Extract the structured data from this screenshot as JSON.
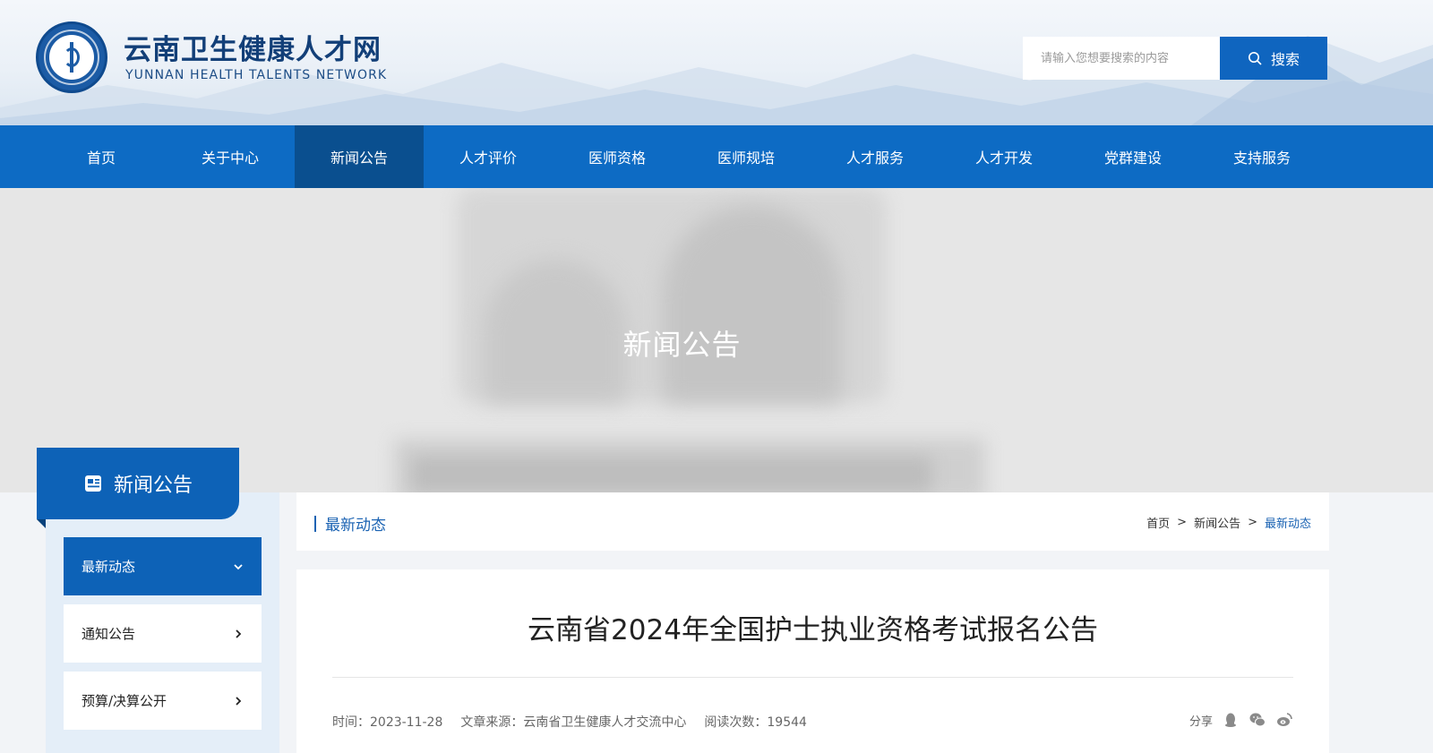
{
  "site": {
    "title": "云南卫生健康人才网",
    "subtitle": "YUNNAN HEALTH TALENTS NETWORK"
  },
  "search": {
    "placeholder": "请输入您想要搜索的内容",
    "button": "搜索"
  },
  "nav": [
    {
      "label": "首页"
    },
    {
      "label": "关于中心"
    },
    {
      "label": "新闻公告",
      "active": true
    },
    {
      "label": "人才评价"
    },
    {
      "label": "医师资格"
    },
    {
      "label": "医师规培"
    },
    {
      "label": "人才服务"
    },
    {
      "label": "人才开发"
    },
    {
      "label": "党群建设"
    },
    {
      "label": "支持服务"
    }
  ],
  "banner": {
    "title": "新闻公告"
  },
  "sidebar": {
    "header": "新闻公告",
    "items": [
      {
        "label": "最新动态",
        "active": true
      },
      {
        "label": "通知公告"
      },
      {
        "label": "预算/决算公开"
      }
    ]
  },
  "section": {
    "title": "最新动态"
  },
  "breadcrumb": {
    "items": [
      "首页",
      "新闻公告",
      "最新动态"
    ],
    "separator": ">"
  },
  "article": {
    "title": "云南省2024年全国护士执业资格考试报名公告",
    "date": "时间：2023-11-28",
    "source": "文章来源：云南省卫生健康人才交流中心",
    "views": "阅读次数：19544",
    "share_label": "分享",
    "share_icons": [
      "qq-icon",
      "wechat-icon",
      "weibo-icon"
    ]
  },
  "colors": {
    "primary": "#0d6bc4",
    "nav_active": "#0a4f8f",
    "sidebar_active": "#0d62b7",
    "link": "#1b63b3"
  }
}
